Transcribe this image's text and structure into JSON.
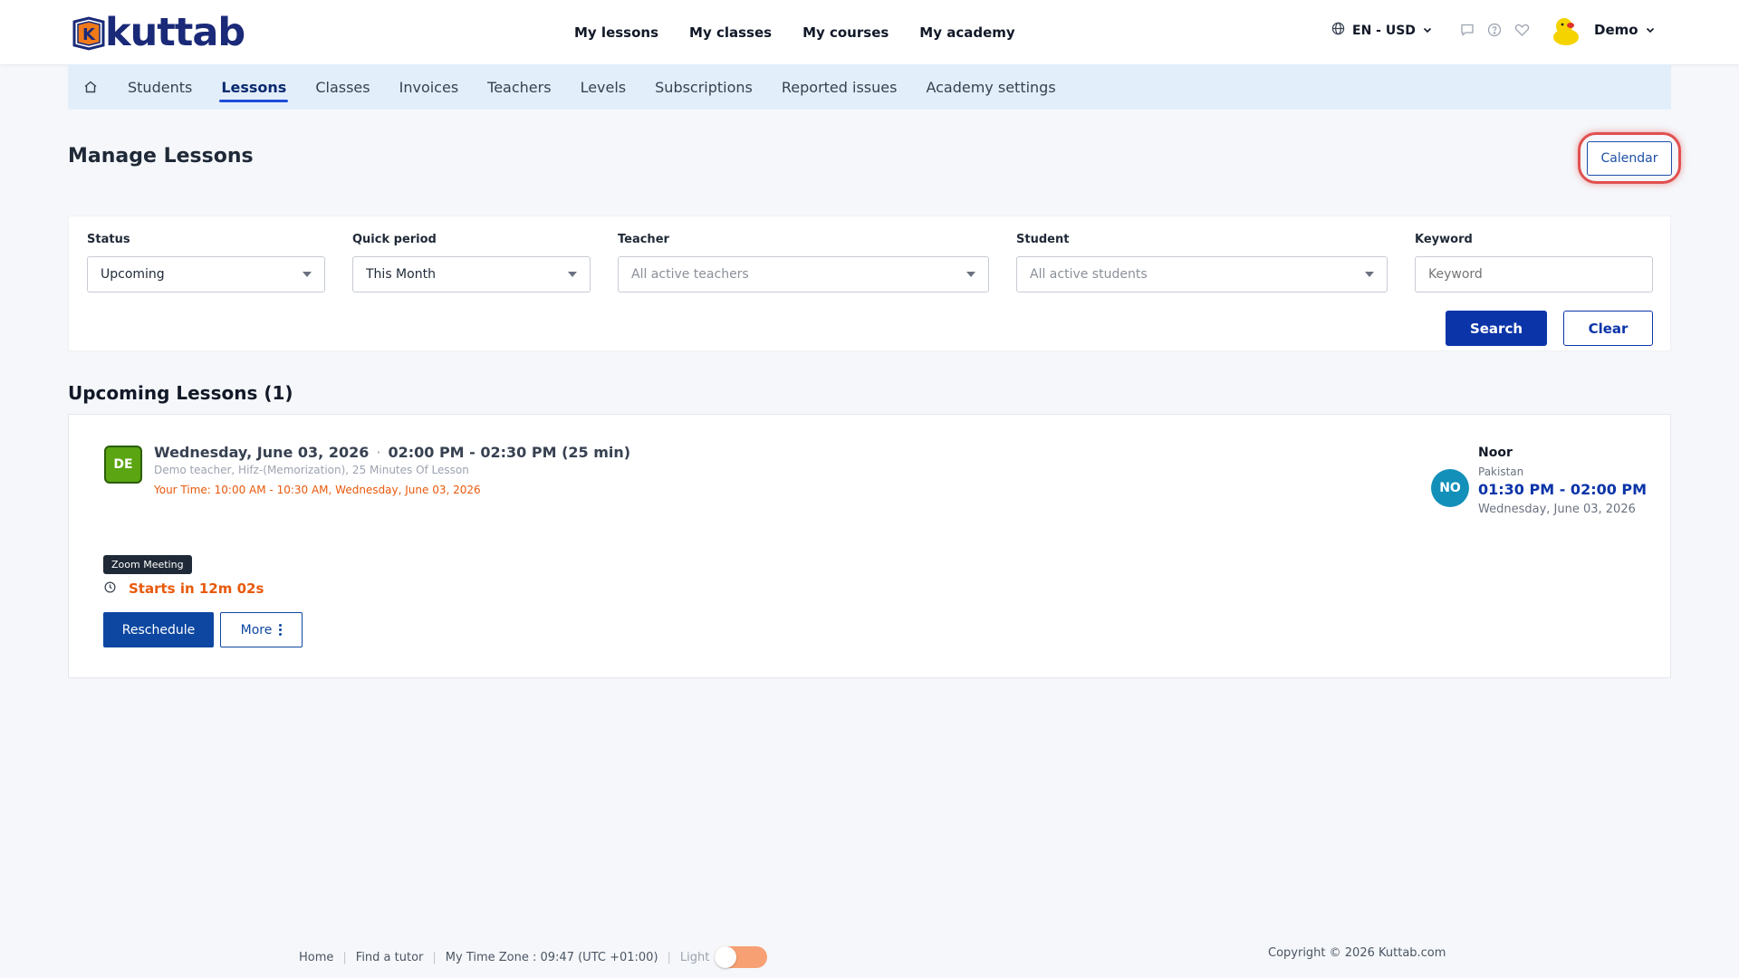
{
  "brand": {
    "name": "kuttab",
    "mark_letter": "K",
    "color": "#1a2a78"
  },
  "main_nav": [
    "My lessons",
    "My classes",
    "My courses",
    "My academy"
  ],
  "header": {
    "lang_currency": "EN - USD",
    "user_name": "Demo"
  },
  "subnav": {
    "tabs": [
      "Students",
      "Lessons",
      "Classes",
      "Invoices",
      "Teachers",
      "Levels",
      "Subscriptions",
      "Reported issues",
      "Academy settings"
    ],
    "active": "Lessons"
  },
  "page": {
    "title": "Manage Lessons",
    "calendar_label": "Calendar"
  },
  "filters": {
    "status": {
      "label": "Status",
      "value": "Upcoming"
    },
    "period": {
      "label": "Quick period",
      "value": "This Month"
    },
    "teacher": {
      "label": "Teacher",
      "placeholder": "All active teachers"
    },
    "student": {
      "label": "Student",
      "placeholder": "All active students"
    },
    "keyword": {
      "label": "Keyword",
      "placeholder": "Keyword"
    },
    "search_label": "Search",
    "clear_label": "Clear"
  },
  "section": {
    "title": "Upcoming Lessons (1)"
  },
  "lesson": {
    "teacher_initials": "DE",
    "date": "Wednesday, June 03, 2026",
    "dot": "·",
    "time": "02:00 PM - 02:30 PM (25 min)",
    "details": "Demo teacher, Hifz-(Memorization), 25 Minutes Of Lesson",
    "your_time": "Your Time: 10:00 AM - 10:30 AM, Wednesday, June 03, 2026",
    "meeting_tag": "Zoom Meeting",
    "countdown": "Starts in 12m 02s",
    "reschedule_label": "Reschedule",
    "more_label": "More",
    "student": {
      "initials": "NO",
      "name": "Noor",
      "country": "Pakistan",
      "time": "01:30 PM - 02:00 PM",
      "date": "Wednesday, June 03, 2026"
    }
  },
  "footer": {
    "home": "Home",
    "find_tutor": "Find a tutor",
    "timezone": "My Time Zone : 09:47 (UTC +01:00)",
    "theme_label": "Light",
    "copyright": "Copyright © 2026 Kuttab.com"
  },
  "colors": {
    "primary": "#0b34a8",
    "accent_orange": "#e8590c",
    "teacher_badge": "#5aa511",
    "student_badge": "#1290b9",
    "subnav_bg": "#e3eefb",
    "highlight_ring": "#e05050"
  }
}
